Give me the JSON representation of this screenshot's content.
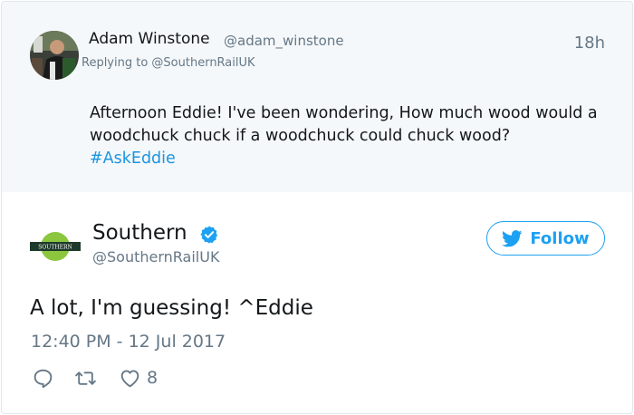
{
  "parent": {
    "name": "Adam Winstone",
    "handle": "@adam_winstone",
    "time": "18h",
    "replying": "Replying to @SouthernRailUK",
    "text": "Afternoon Eddie! I've been wondering, How much wood would a woodchuck chuck if a woodchuck could chuck wood?",
    "hashtag": "#AskEddie"
  },
  "tweet": {
    "name": "Southern",
    "handle": "@SouthernRailUK",
    "follow_label": "Follow",
    "text": "A lot, I'm guessing! ^Eddie",
    "timestamp": "12:40 PM - 12 Jul 2017",
    "likes": "8",
    "logo_text": "SOUTHERN"
  },
  "colors": {
    "accent": "#1da1f2",
    "hashtag": "#1b95e0",
    "secondary_text": "#657786",
    "parent_bg": "#f5f8fa",
    "brand_green": "#8cc63f",
    "brand_dark": "#1e3a2a"
  },
  "icons": [
    "verified-badge-icon",
    "twitter-bird-icon",
    "reply-icon",
    "retweet-icon",
    "heart-icon"
  ]
}
